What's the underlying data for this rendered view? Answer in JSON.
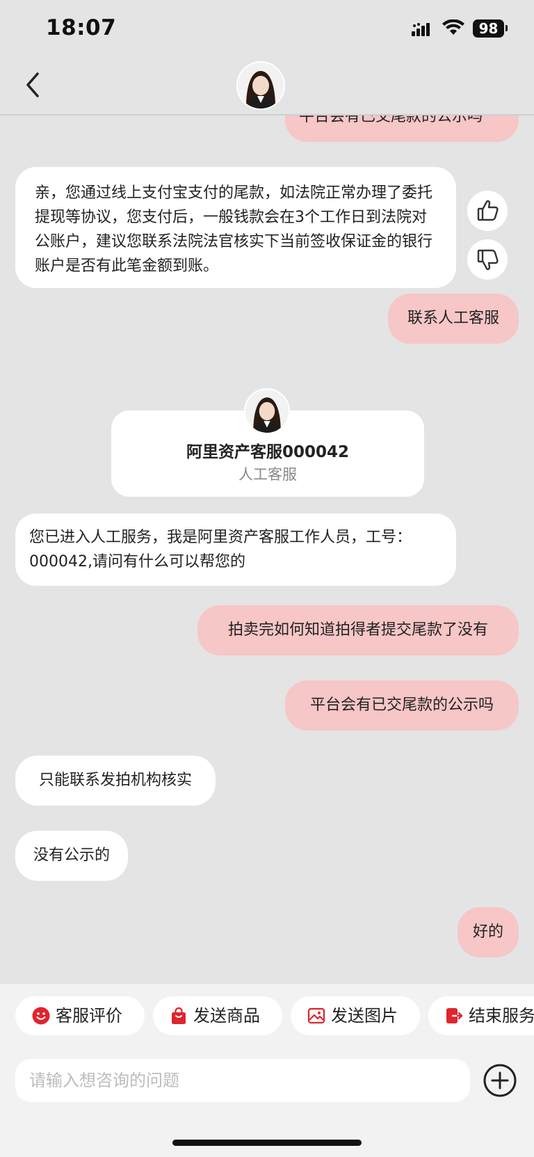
{
  "status_bar": {
    "time": "18:07",
    "battery": "98"
  },
  "header": {
    "back_icon": "chevron-left-icon",
    "avatar_icon": "agent-avatar-icon"
  },
  "messages": {
    "m0": "平台会有已交尾款的公示吗",
    "m1": "亲，您通过线上支付宝支付的尾款，如法院正常办理了委托提现等协议，您支付后，一般钱款会在3个工作日到法院对公账户，建议您联系法院法官核实下当前签收保证金的银行账户是否有此笔金额到账。",
    "m2": "联系人工客服",
    "m4": "您已进入人工服务，我是阿里资产客服工作人员，工号：000042,请问有什么可以帮您的",
    "m5": "拍卖完如何知道拍得者提交尾款了没有",
    "m6": "平台会有已交尾款的公示吗",
    "m7": "只能联系发拍机构核实",
    "m8": "没有公示的",
    "m9": "好的"
  },
  "agent_card": {
    "name": "阿里资产客服000042",
    "role": "人工客服"
  },
  "quick_actions": [
    {
      "label": "客服评价",
      "icon": "smiley-icon"
    },
    {
      "label": "发送商品",
      "icon": "shopping-bag-icon"
    },
    {
      "label": "发送图片",
      "icon": "image-icon"
    },
    {
      "label": "结束服务",
      "icon": "exit-icon"
    }
  ],
  "input": {
    "placeholder": "请输入想咨询的问题"
  },
  "colors": {
    "user_bubble": "#f7c6c6",
    "accent_red": "#e0242c",
    "background": "#e4e4e4"
  }
}
